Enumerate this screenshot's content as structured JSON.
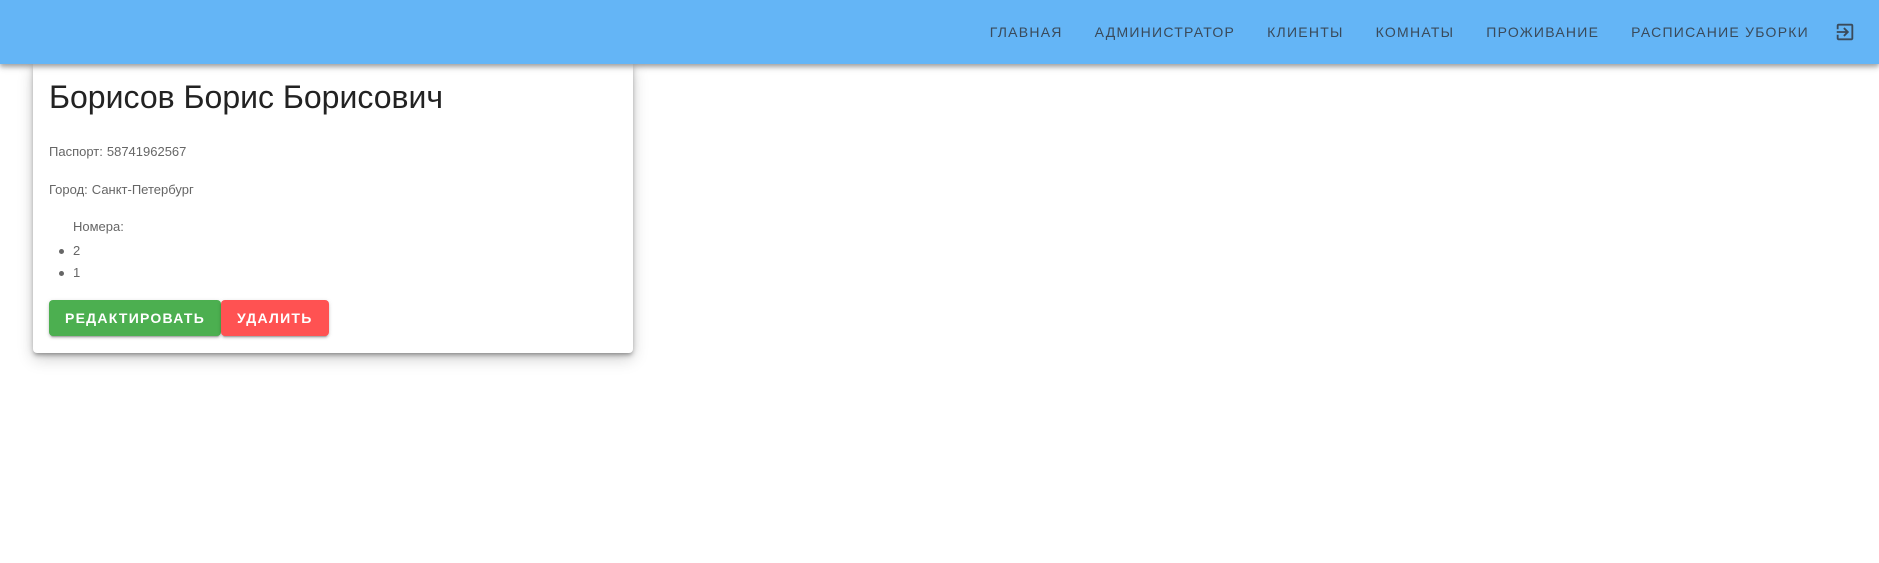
{
  "nav": {
    "items": [
      {
        "label": "ГЛАВНАЯ"
      },
      {
        "label": "АДМИНИСТРАТОР"
      },
      {
        "label": "КЛИЕНТЫ"
      },
      {
        "label": "КОМНАТЫ"
      },
      {
        "label": "ПРОЖИВАНИЕ"
      },
      {
        "label": "РАСПИСАНИЕ УБОРКИ"
      }
    ],
    "logout_icon": "logout-icon"
  },
  "client": {
    "name": "Борисов Борис Борисович",
    "passport_label": "Паспорт:",
    "passport": "58741962567",
    "city_label": "Город:",
    "city": "Санкт-Петербург",
    "rooms_label": "Номера:",
    "rooms": [
      "2",
      "1"
    ]
  },
  "actions": {
    "edit_label": "РЕДАКТИРОВАТЬ",
    "delete_label": "УДАЛИТЬ"
  },
  "colors": {
    "appbar": "#64b5f6",
    "edit": "#4caf50",
    "delete": "#ff5252"
  }
}
